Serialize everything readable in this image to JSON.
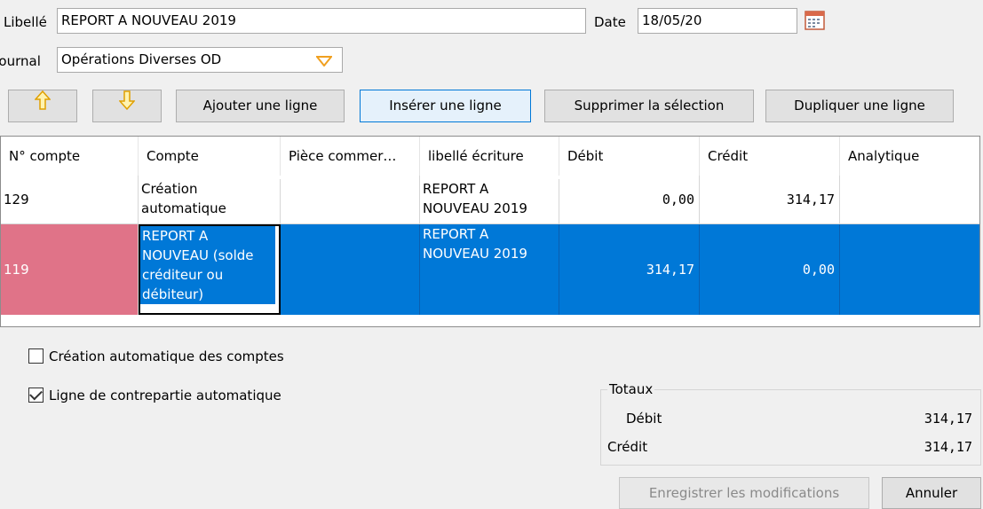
{
  "form": {
    "libelle_label": "Libellé",
    "libelle_value": "REPORT A NOUVEAU 2019",
    "date_label": "Date",
    "date_value": "18/05/20",
    "journal_label": "Journal",
    "journal_value": "Opérations Diverses OD"
  },
  "toolbar": {
    "move_up_icon": "arrow-up-icon",
    "move_down_icon": "arrow-down-icon",
    "add_line": "Ajouter une ligne",
    "insert_line": "Insérer une ligne",
    "delete_selection": "Supprimer la sélection",
    "duplicate_line": "Dupliquer une ligne"
  },
  "grid": {
    "columns": [
      "N° compte",
      "Compte",
      "Pièce commer…",
      "libellé écriture",
      "Débit",
      "Crédit",
      "Analytique"
    ],
    "rows": [
      {
        "numero": "129",
        "compte": "Création\nautomatique",
        "piece": "",
        "libelle": "REPORT A\nNOUVEAU 2019",
        "debit": "0,00",
        "credit": "314,17",
        "analytique": ""
      },
      {
        "numero": "119",
        "compte": "REPORT A\nNOUVEAU (solde\ncréditeur ou\ndébiteur)",
        "piece": "",
        "libelle": "REPORT A\nNOUVEAU 2019",
        "debit": "314,17",
        "credit": "0,00",
        "analytique": "",
        "selected": true
      }
    ]
  },
  "options": {
    "auto_accounts_label": "Création automatique des comptes",
    "auto_accounts_checked": false,
    "auto_counterpart_label": "Ligne de contrepartie automatique",
    "auto_counterpart_checked": true
  },
  "totals": {
    "title": "Totaux",
    "debit_label": "Débit",
    "debit_value": "314,17",
    "credit_label": "Crédit",
    "credit_value": "314,17"
  },
  "footer": {
    "save_label": "Enregistrer les modifications",
    "cancel_label": "Annuler"
  },
  "colors": {
    "selection": "#0078d7",
    "error_cell": "#e07388",
    "dropdown_arrow": "#f0a020"
  }
}
